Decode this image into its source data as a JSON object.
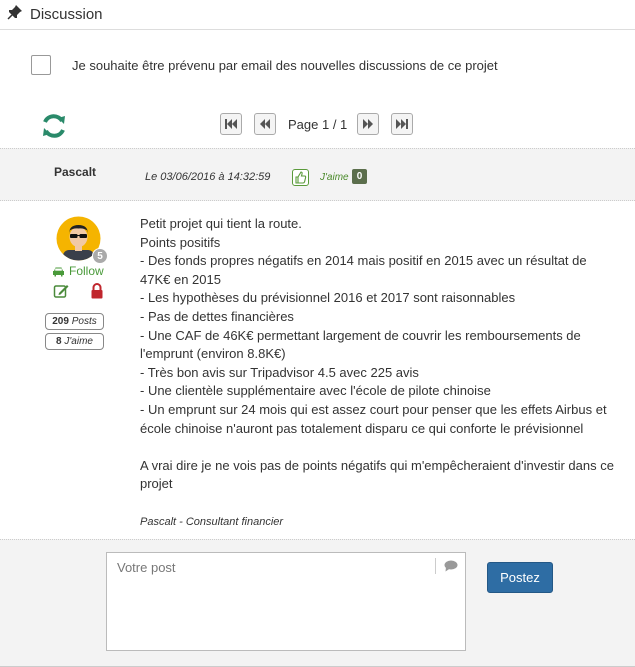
{
  "header": {
    "title": "Discussion",
    "icon": "pin-icon"
  },
  "notify": {
    "checked": false,
    "label": "Je souhaite être prévenu par email des nouvelles discussions de ce projet"
  },
  "pagination": {
    "label": "Page 1 / 1",
    "buttons": [
      "first-page",
      "previous-page",
      "next-page",
      "last-page"
    ]
  },
  "post": {
    "author": "Pascalt",
    "date": "Le 03/06/2016 à 14:32:59",
    "like_label": "J'aime",
    "like_count": "0",
    "level_badge": "5",
    "follow_label": "Follow",
    "posts_count": "209",
    "posts_label": "Posts",
    "likes_count": "8",
    "likes_label": "J'aime",
    "body_lines": [
      "Petit projet qui tient la route.",
      "Points positifs",
      "- Des fonds propres négatifs en 2014 mais positif en 2015 avec un résultat de 47K€ en 2015",
      "- Les hypothèses du prévisionnel 2016 et 2017 sont raisonnables",
      "- Pas de dettes financières",
      "- Une CAF de 46K€ permettant largement de couvrir les remboursements de l'emprunt (environ 8.8K€)",
      "- Très bon avis sur Tripadvisor 4.5 avec 225 avis",
      "- Une clientèle supplémentaire avec l'école de pilote chinoise",
      "- Un emprunt sur 24 mois qui est assez court pour penser que les effets Airbus et école chinoise n'auront pas totalement disparu ce qui conforte le prévisionnel",
      "",
      "A vrai dire je ne vois pas de points négatifs qui m'empêcheraient d'investir dans ce projet"
    ],
    "signature": "Pascalt - Consultant financier"
  },
  "reply": {
    "placeholder": "Votre post",
    "submit_label": "Postez"
  },
  "colors": {
    "accent_green": "#4a9a3a",
    "button_blue": "#2e6da4",
    "lock_red": "#c0262d",
    "refresh_teal": "#2a8a6a"
  }
}
